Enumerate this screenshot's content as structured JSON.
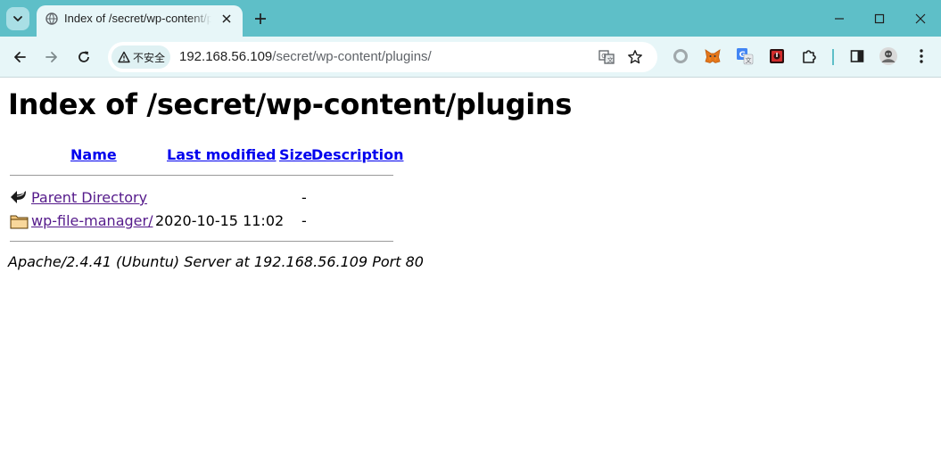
{
  "browser": {
    "tab": {
      "title": "Index of /secret/wp-content/plugins"
    },
    "security_label": "不安全",
    "url": {
      "host": "192.168.56.109",
      "path": "/secret/wp-content/plugins/"
    },
    "colors": {
      "frame": "#5ebfc8",
      "toolbar": "#e7f6f8"
    },
    "extensions": [
      "circle-extension-icon",
      "metamask-fox-icon",
      "google-translate-extension-icon",
      "red-square-extension-icon",
      "puzzle-extensions-icon"
    ]
  },
  "page": {
    "heading": "Index of /secret/wp-content/plugins",
    "columns": {
      "name": "Name",
      "last_modified": "Last modified",
      "size": "Size",
      "description": "Description"
    },
    "rows": [
      {
        "name": "Parent Directory",
        "last_modified": "",
        "size": "-",
        "description": "",
        "icon": "back-arrow-icon"
      },
      {
        "name": "wp-file-manager/",
        "last_modified": "2020-10-15 11:02",
        "size": "-",
        "description": "",
        "icon": "folder-icon"
      }
    ],
    "address": "Apache/2.4.41 (Ubuntu) Server at 192.168.56.109 Port 80",
    "colors": {
      "link": "#0000ee",
      "visited": "#551a8b"
    }
  }
}
